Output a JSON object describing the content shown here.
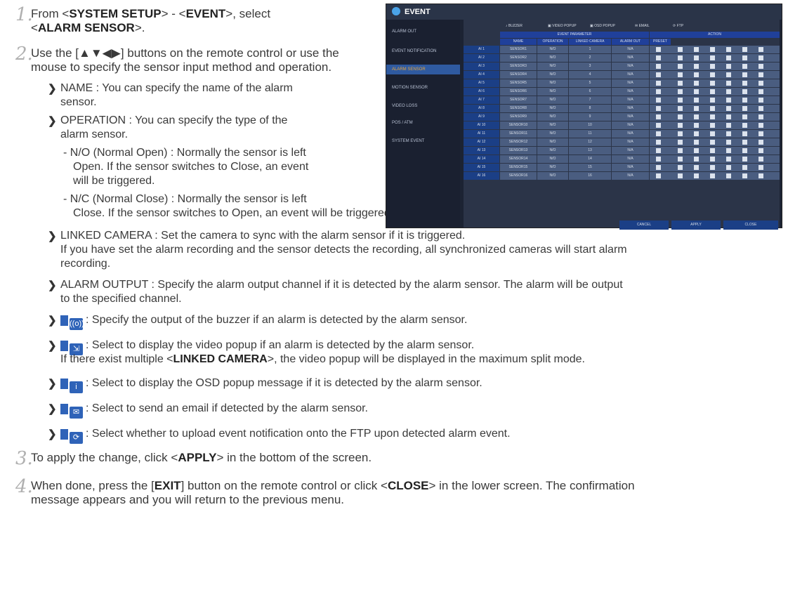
{
  "steps": [
    {
      "num": "1.",
      "text_a": "From <",
      "sys": "SYSTEM SETUP",
      "text_b": "> - <",
      "evt": "EVENT",
      "text_c": ">, select",
      "line2_a": "<",
      "alarm": "ALARM SENSOR",
      "line2_b": ">."
    },
    {
      "num": "2.",
      "line1": "Use the [▲▼◀▶] buttons on the remote control or use the",
      "line2": "mouse to specify the sensor input method and operation."
    },
    {
      "num": "3.",
      "text_a": "To apply the change, click <",
      "apply": "APPLY",
      "text_b": "> in the bottom of the screen."
    },
    {
      "num": "4.",
      "text_a": "When done, press the [",
      "exit": "EXIT",
      "text_b": "] button on the remote control or click <",
      "close": "CLOSE",
      "text_c": "> in the lower screen. The confirmation",
      "line2": "message appears and you will return to the previous menu."
    }
  ],
  "bullets": {
    "name_1": "NAME : You can specify the name of the alarm",
    "name_2": "sensor.",
    "op_1": "OPERATION : You can specify the type of the",
    "op_2": "alarm sensor.",
    "no_1": "- N/O (Normal Open) : Normally the sensor is left",
    "no_2": "Open. If the sensor switches to Close, an event",
    "no_3": "will be triggered.",
    "nc_1": "- N/C (Normal Close) : Normally the sensor is left",
    "nc_2": "Close. If the sensor switches to Open, an event will be triggered.",
    "lc_1": "LINKED CAMERA : Set the camera to sync with the alarm sensor if it is triggered.",
    "lc_2": "If you have set the alarm recording and the sensor detects the recording, all synchronized cameras will start alarm",
    "lc_3": "recording.",
    "ao_1": "ALARM OUTPUT : Specify the alarm output channel if it is detected by the alarm sensor. The alarm will be output",
    "ao_2": "to the specified channel.",
    "buzzer": ": Specify the output of the buzzer if an alarm is detected by the alarm sensor.",
    "video_1": ": Select to display the video popup if an alarm is detected by the alarm sensor.",
    "video_2a": "If there exist multiple <",
    "video_lc": "LINKED CAMERA",
    "video_2b": ">, the video popup will be displayed in the maximum split mode.",
    "osd": ": Select to display the OSD popup message if it is detected by the alarm sensor.",
    "email": ": Select to send an email if detected by the alarm sensor.",
    "ftp": ": Select whether to upload event notification onto the FTP upon detected alarm event."
  },
  "screen": {
    "title": "EVENT",
    "sidebar": [
      "ALARM OUT",
      "EVENT NOTIFICATION",
      "ALARM SENSOR",
      "MOTION SENSOR",
      "VIDEO LOSS",
      "POS / ATM",
      "SYSTEM EVENT"
    ],
    "legend": [
      "BUZZER",
      "VIDEO POPUP",
      "OSD POPUP",
      "EMAIL",
      "FTP"
    ],
    "group_event": "EVENT PARAMETER",
    "group_action": "ACTION",
    "columns": [
      "NAME",
      "OPERATION",
      "LINKED CAMERA",
      "ALARM OUT",
      "PRESET"
    ],
    "rows": [
      {
        "id": "AI 1",
        "name": "SENSOR1",
        "op": "N/O",
        "cam": "1",
        "out": "N/A"
      },
      {
        "id": "AI 2",
        "name": "SENSOR2",
        "op": "N/O",
        "cam": "2",
        "out": "N/A"
      },
      {
        "id": "AI 3",
        "name": "SENSOR3",
        "op": "N/O",
        "cam": "3",
        "out": "N/A"
      },
      {
        "id": "AI 4",
        "name": "SENSOR4",
        "op": "N/O",
        "cam": "4",
        "out": "N/A"
      },
      {
        "id": "AI 5",
        "name": "SENSOR5",
        "op": "N/O",
        "cam": "5",
        "out": "N/A"
      },
      {
        "id": "AI 6",
        "name": "SENSOR6",
        "op": "N/O",
        "cam": "6",
        "out": "N/A"
      },
      {
        "id": "AI 7",
        "name": "SENSOR7",
        "op": "N/O",
        "cam": "7",
        "out": "N/A"
      },
      {
        "id": "AI 8",
        "name": "SENSOR8",
        "op": "N/O",
        "cam": "8",
        "out": "N/A"
      },
      {
        "id": "AI 9",
        "name": "SENSOR9",
        "op": "N/O",
        "cam": "9",
        "out": "N/A"
      },
      {
        "id": "AI 10",
        "name": "SENSOR10",
        "op": "N/O",
        "cam": "10",
        "out": "N/A"
      },
      {
        "id": "AI 11",
        "name": "SENSOR11",
        "op": "N/O",
        "cam": "11",
        "out": "N/A"
      },
      {
        "id": "AI 12",
        "name": "SENSOR12",
        "op": "N/O",
        "cam": "12",
        "out": "N/A"
      },
      {
        "id": "AI 13",
        "name": "SENSOR13",
        "op": "N/O",
        "cam": "13",
        "out": "N/A"
      },
      {
        "id": "AI 14",
        "name": "SENSOR14",
        "op": "N/O",
        "cam": "14",
        "out": "N/A"
      },
      {
        "id": "AI 15",
        "name": "SENSOR15",
        "op": "N/O",
        "cam": "15",
        "out": "N/A"
      },
      {
        "id": "AI 16",
        "name": "SENSOR16",
        "op": "N/O",
        "cam": "16",
        "out": "N/A"
      }
    ],
    "buttons": [
      "CANCEL",
      "APPLY",
      "CLOSE"
    ]
  }
}
